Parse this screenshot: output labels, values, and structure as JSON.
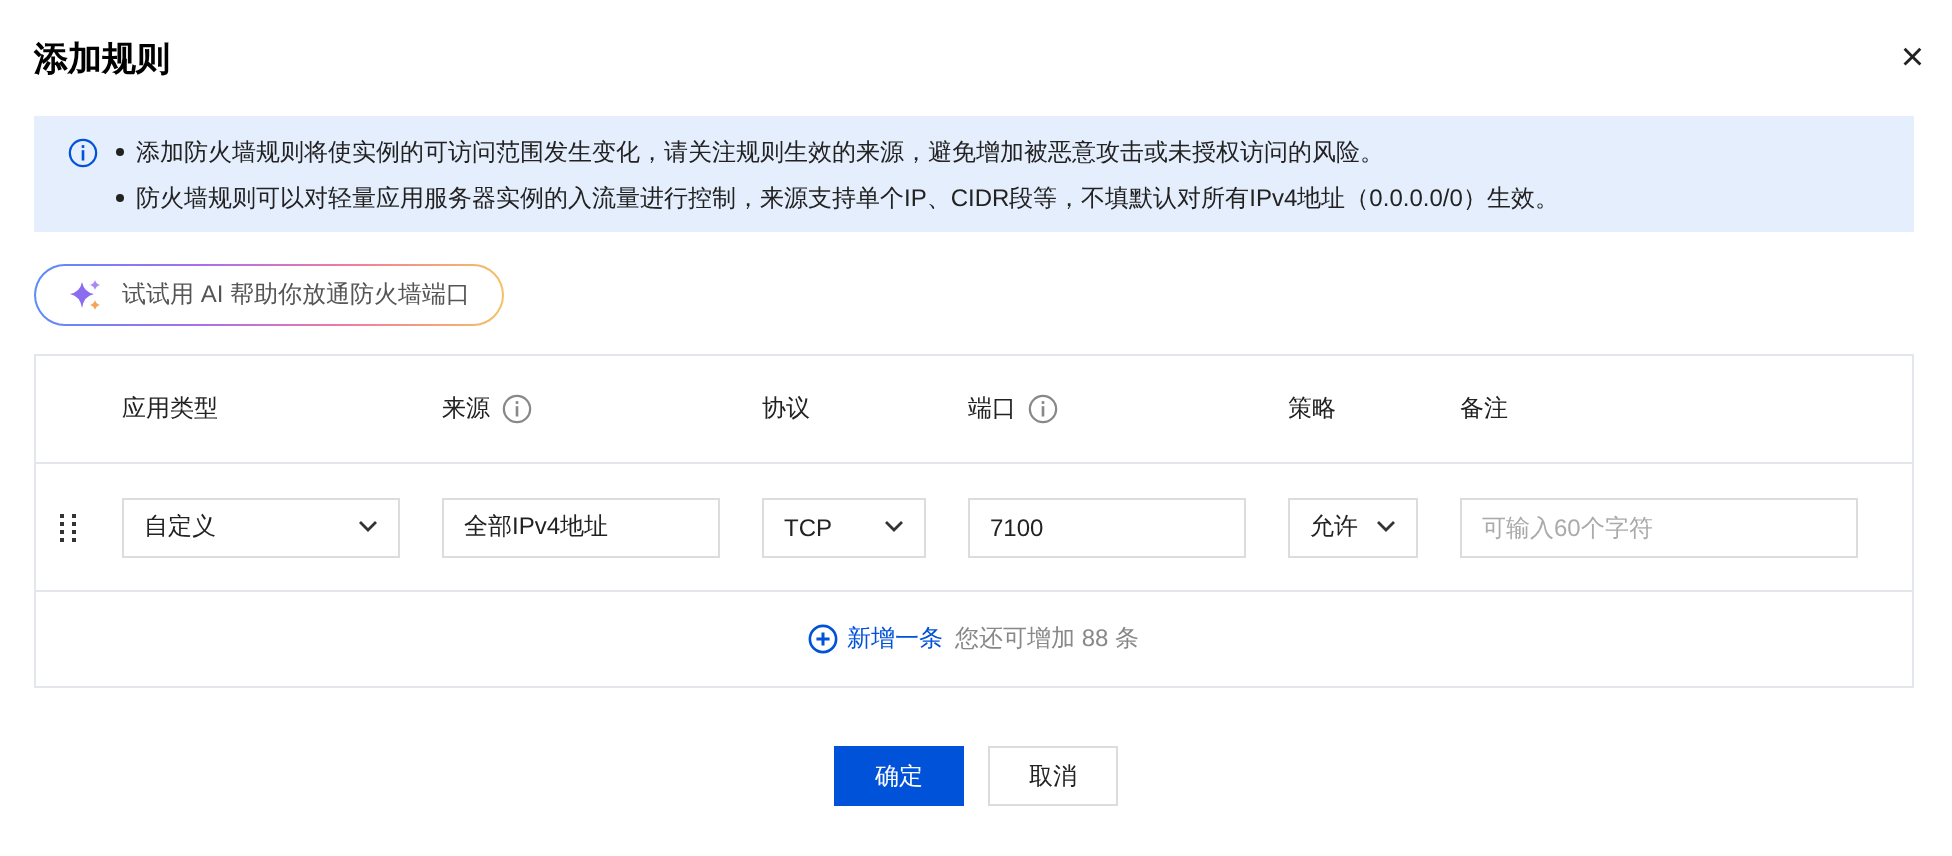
{
  "dialog": {
    "title": "添加规则",
    "close": "×"
  },
  "notice": {
    "lines": [
      "添加防火墙规则将使实例的可访问范围发生变化，请关注规则生效的来源，避免增加被恶意攻击或未授权访问的风险。",
      "防火墙规则可以对轻量应用服务器实例的入流量进行控制，来源支持单个IP、CIDR段等，不填默认对所有IPv4地址（0.0.0.0/0）生效。"
    ]
  },
  "ai_button": {
    "label": "试试用 AI 帮助你放通防火墙端口"
  },
  "table": {
    "columns": [
      {
        "label": "应用类型",
        "kind": "plain"
      },
      {
        "label": "来源",
        "kind": "with_info"
      },
      {
        "label": "协议",
        "kind": "plain"
      },
      {
        "label": "端口",
        "kind": "with_info"
      },
      {
        "label": "策略",
        "kind": "plain"
      },
      {
        "label": "备注",
        "kind": "plain"
      }
    ],
    "rows": [
      {
        "cells": [
          {
            "kind": "select",
            "value": "自定义"
          },
          {
            "kind": "input",
            "value": "全部IPv4地址"
          },
          {
            "kind": "select",
            "value": "TCP"
          },
          {
            "kind": "input",
            "value": "7100"
          },
          {
            "kind": "select",
            "value": "允许"
          },
          {
            "kind": "input",
            "placeholder": "可输入60个字符"
          }
        ]
      }
    ],
    "add_link": "新增一条",
    "add_hint": "您还可增加 88 条"
  },
  "buttons": [
    {
      "label": "确定",
      "kind": "primary"
    },
    {
      "label": "取消",
      "kind": "default"
    }
  ]
}
